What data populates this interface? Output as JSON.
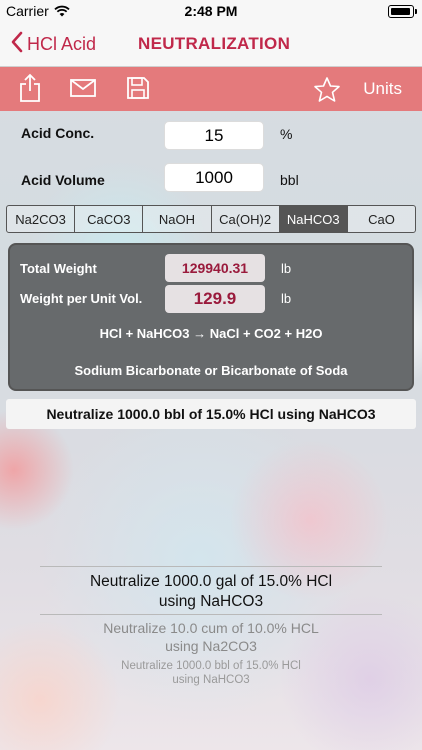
{
  "status": {
    "carrier": "Carrier",
    "time": "2:48 PM"
  },
  "nav": {
    "back_label": "HCl Acid",
    "title": "NEUTRALIZATION"
  },
  "toolbar": {
    "units_label": "Units"
  },
  "inputs": {
    "acid_conc": {
      "label": "Acid Conc.",
      "value": "15",
      "unit": "%"
    },
    "acid_volume": {
      "label": "Acid Volume",
      "value": "1000",
      "unit": "bbl"
    }
  },
  "bases": [
    "Na2CO3",
    "CaCO3",
    "NaOH",
    "Ca(OH)2",
    "NaHCO3",
    "CaO"
  ],
  "selected_base": "NaHCO3",
  "results": {
    "total_weight": {
      "label": "Total Weight",
      "value": "129940.31",
      "unit": "lb"
    },
    "weight_per_unit": {
      "label": "Weight per Unit Vol.",
      "value": "129.9",
      "unit": "lb"
    },
    "equation": "HCl + NaHCO3 → NaCl + CO2 + H2O",
    "compound_name": "Sodium Bicarbonate or Bicarbonate of Soda"
  },
  "summary": "Neutralize 1000.0 bbl of 15.0% HCl using NaHCO3",
  "history": [
    {
      "line1": "Neutralize 1000.0 gal of 15.0% HCl",
      "line2": "using NaHCO3"
    },
    {
      "line1": "Neutralize 10.0 cum of 10.0% HCL",
      "line2": "using Na2CO3"
    },
    {
      "line1": "Neutralize 1000.0 bbl of 15.0% HCl",
      "line2": "using NaHCO3"
    }
  ],
  "colors": {
    "accent": "#c0284a",
    "toolbar": "#e47a7c",
    "panel": "#676a6c",
    "value_text": "#9a1a3c"
  },
  "icons": [
    "back-chevron-icon",
    "share-icon",
    "mail-icon",
    "save-icon",
    "star-icon",
    "wifi-icon",
    "battery-icon"
  ]
}
